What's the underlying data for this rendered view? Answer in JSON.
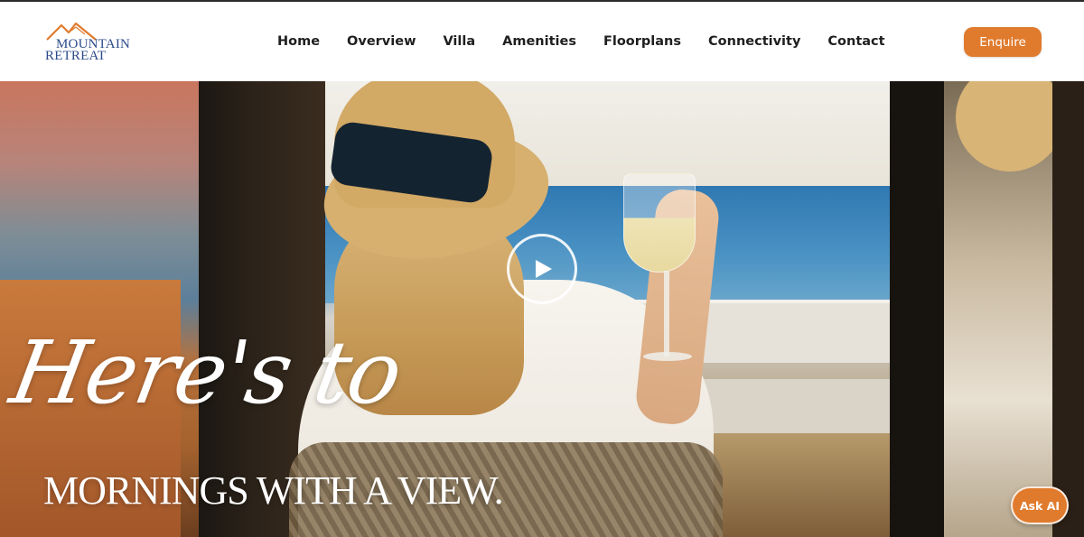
{
  "brand": {
    "logo_line1": "MOUNTAIN",
    "logo_line2": "RETREAT",
    "logo_icon": "mountain-peaks-icon",
    "accent_color": "#e07b2e",
    "logo_color": "#2b4a8a"
  },
  "nav": {
    "items": [
      {
        "label": "Home"
      },
      {
        "label": "Overview"
      },
      {
        "label": "Villa"
      },
      {
        "label": "Amenities"
      },
      {
        "label": "Floorplans"
      },
      {
        "label": "Connectivity"
      },
      {
        "label": "Contact"
      }
    ],
    "cta_label": "Enquire"
  },
  "hero": {
    "script_text": "Here's to",
    "headline": "MORNINGS WITH A VIEW.",
    "play_icon": "play-icon"
  },
  "widgets": {
    "ask_ai_label": "Ask AI"
  }
}
